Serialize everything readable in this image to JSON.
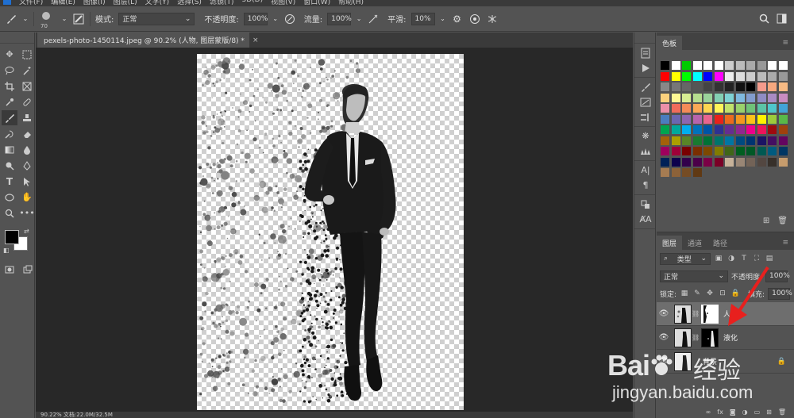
{
  "menubar": {
    "items": [
      "文件(F)",
      "编辑(E)",
      "图像(I)",
      "图层(L)",
      "文字(Y)",
      "选择(S)",
      "滤镜(T)",
      "3D(D)",
      "视图(V)",
      "窗口(W)",
      "帮助(H)"
    ]
  },
  "options": {
    "brush_size": "70",
    "mode_label": "模式:",
    "mode_value": "正常",
    "opacity_label": "不透明度:",
    "opacity_value": "100%",
    "flow_label": "流量:",
    "flow_value": "100%",
    "smooth_label": "平滑:",
    "smooth_value": "10%"
  },
  "document": {
    "tab_title": "pexels-photo-1450114.jpeg @ 90.2% (人物, 图层蒙版/8) *",
    "close": "×"
  },
  "status": {
    "text": "90.22%   文档:22.0M/32.5M"
  },
  "swatches_panel": {
    "tab": "色板",
    "colors": [
      "#000000",
      "#ffffff",
      "#00cc00",
      "#ffffff",
      "#ffffff",
      "#ffffff",
      "#cccccc",
      "#bbbbbb",
      "#aaaaaa",
      "#999999",
      "#ffffff",
      "#ffffff",
      "#ff0000",
      "#ffff00",
      "#00ff00",
      "#00ffff",
      "#0000ff",
      "#ff00ff",
      "#eeeeee",
      "#dddddd",
      "#cccccc",
      "#bbbbbb",
      "#aaaaaa",
      "#999999",
      "#888888",
      "#777777",
      "#666666",
      "#555555",
      "#444444",
      "#333333",
      "#222222",
      "#111111",
      "#000000",
      "#f49b8c",
      "#f6a87e",
      "#f8bb84",
      "#fbd17d",
      "#fff894",
      "#d8ed92",
      "#b6dc8e",
      "#9ad29a",
      "#83cfb3",
      "#7ed2d4",
      "#7fb9de",
      "#829ccd",
      "#8f8cc4",
      "#a98bc3",
      "#c98cc1",
      "#ec8fa9",
      "#f26c5b",
      "#f58b58",
      "#faa856",
      "#fdd551",
      "#fff45a",
      "#c1e26b",
      "#99d16c",
      "#6fc278",
      "#5bc3a6",
      "#4fc6cb",
      "#42a4d8",
      "#4b7dbf",
      "#6b66b1",
      "#8d65b0",
      "#b764ad",
      "#e9658f",
      "#e8211b",
      "#ec6a1e",
      "#f39720",
      "#fbc21a",
      "#fff200",
      "#9ccb3b",
      "#59b948",
      "#00a54f",
      "#00a99d",
      "#00aeef",
      "#0072bc",
      "#0054a6",
      "#2e3192",
      "#662d91",
      "#92278f",
      "#ec008c",
      "#ed145b",
      "#9e0b0f",
      "#a0410d",
      "#a36209",
      "#aba000",
      "#598527",
      "#197b30",
      "#007236",
      "#00746b",
      "#0076a3",
      "#004a80",
      "#003471",
      "#1b1464",
      "#440e62",
      "#630460",
      "#9e005d",
      "#9e0039",
      "#790000",
      "#7b2e00",
      "#7d4900",
      "#827b00",
      "#406618",
      "#005e20",
      "#005826",
      "#005952",
      "#005b7f",
      "#003663",
      "#002157",
      "#0d004c",
      "#32004b",
      "#4b0049",
      "#7b0046",
      "#7a0026",
      "#c7b299",
      "#998675",
      "#736357",
      "#534741",
      "#37302a",
      "#c69c6d",
      "#a67c52",
      "#8c6239",
      "#754c24",
      "#603913"
    ]
  },
  "layers_panel": {
    "tabs": [
      "图层",
      "通道",
      "路径"
    ],
    "filter_label": "类型",
    "blend_mode": "正常",
    "opacity_label": "不透明度:",
    "opacity_value": "100%",
    "lock_label": "锁定:",
    "fill_label": "填充:",
    "fill_value": "100%",
    "layers": [
      {
        "name": "人物"
      },
      {
        "name": "液化"
      },
      {
        "name": "背景"
      }
    ]
  },
  "watermark": {
    "logo": "Bai",
    "logo2": "经验",
    "url": "jingyan.baidu.com"
  },
  "colors": {
    "foreground": "#000000",
    "background": "#ffffff",
    "arrow": "#e8201e"
  }
}
